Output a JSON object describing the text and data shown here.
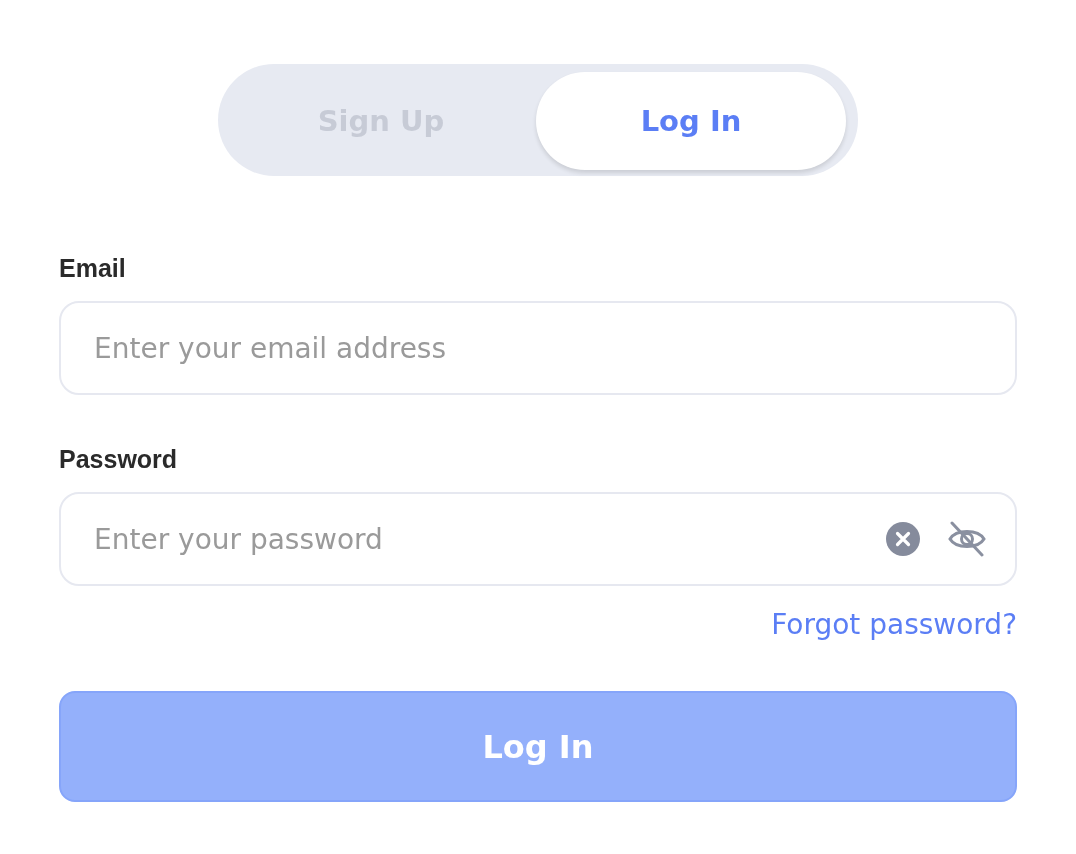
{
  "tabs": [
    {
      "label": "Sign Up",
      "selected": false
    },
    {
      "label": "Log In",
      "selected": true
    }
  ],
  "fields": [
    {
      "label": "Email",
      "placeholder": "Enter your email address",
      "kind": "text"
    },
    {
      "label": "Password",
      "placeholder": "Enter your password",
      "kind": "password"
    }
  ],
  "forgot_link": "Forgot password?",
  "submit": {
    "label": "Log In",
    "disabled": true
  }
}
